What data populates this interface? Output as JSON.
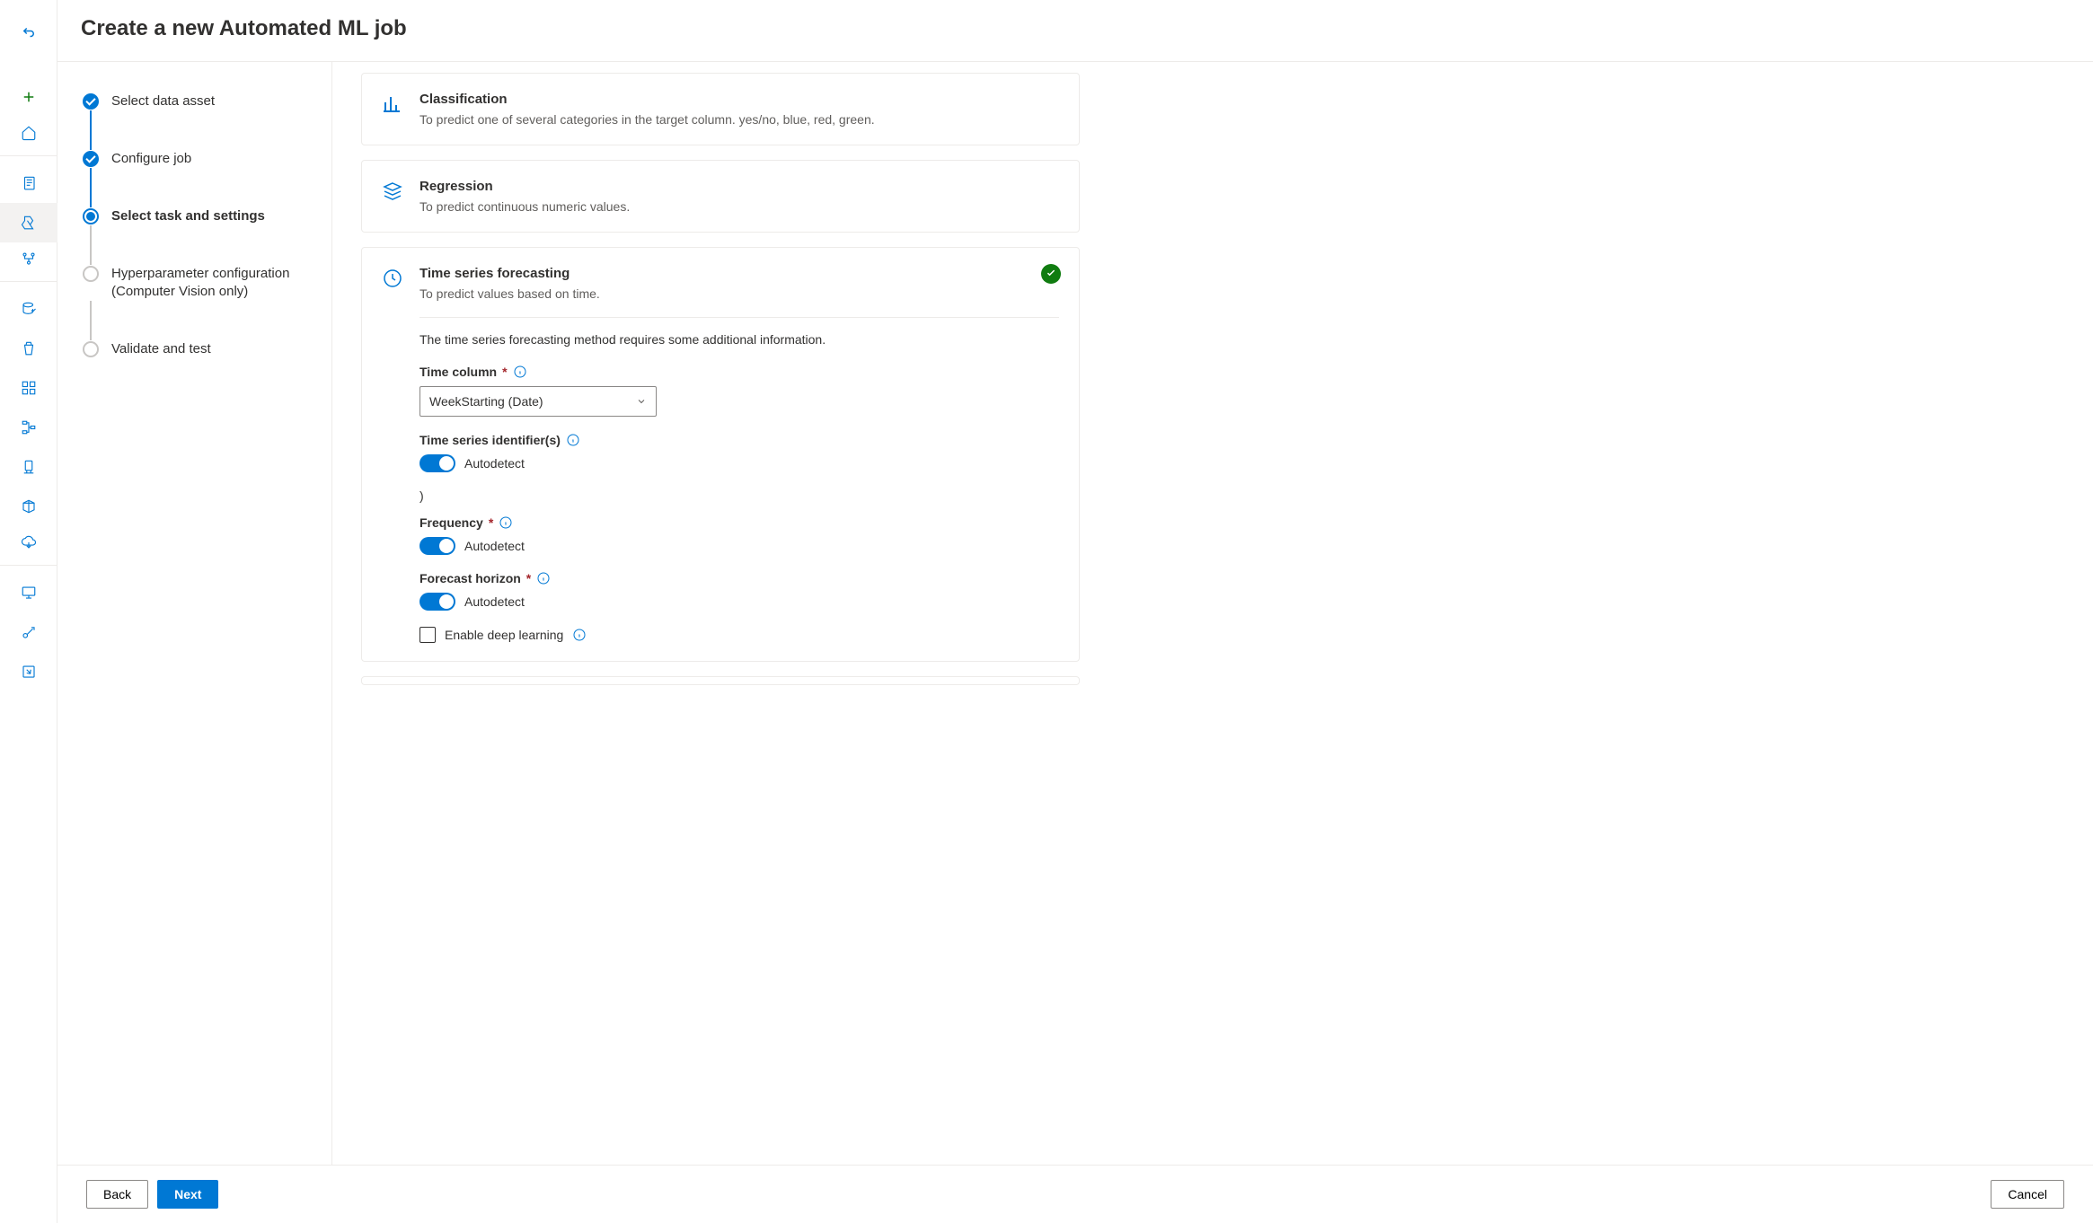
{
  "header": {
    "title": "Create a new Automated ML job"
  },
  "steps": [
    {
      "label": "Select data asset",
      "state": "done"
    },
    {
      "label": "Configure job",
      "state": "done"
    },
    {
      "label": "Select task and settings",
      "state": "current"
    },
    {
      "label": "Hyperparameter configuration (Computer Vision only)",
      "state": "todo"
    },
    {
      "label": "Validate and test",
      "state": "todo"
    }
  ],
  "tasks": {
    "classification": {
      "title": "Classification",
      "desc": "To predict one of several categories in the target column. yes/no, blue, red, green."
    },
    "regression": {
      "title": "Regression",
      "desc": "To predict continuous numeric values."
    },
    "forecasting": {
      "title": "Time series forecasting",
      "desc": "To predict values based on time."
    }
  },
  "forecasting_settings": {
    "intro": "The time series forecasting method requires some additional information.",
    "time_column": {
      "label": "Time column",
      "value": "WeekStarting (Date)"
    },
    "ts_identifiers": {
      "label": "Time series identifier(s)",
      "toggle_label": "Autodetect"
    },
    "stray_text": ")",
    "frequency": {
      "label": "Frequency",
      "toggle_label": "Autodetect"
    },
    "horizon": {
      "label": "Forecast horizon",
      "toggle_label": "Autodetect"
    },
    "deep_learning": {
      "label": "Enable deep learning"
    }
  },
  "footer": {
    "back": "Back",
    "next": "Next",
    "cancel": "Cancel"
  }
}
